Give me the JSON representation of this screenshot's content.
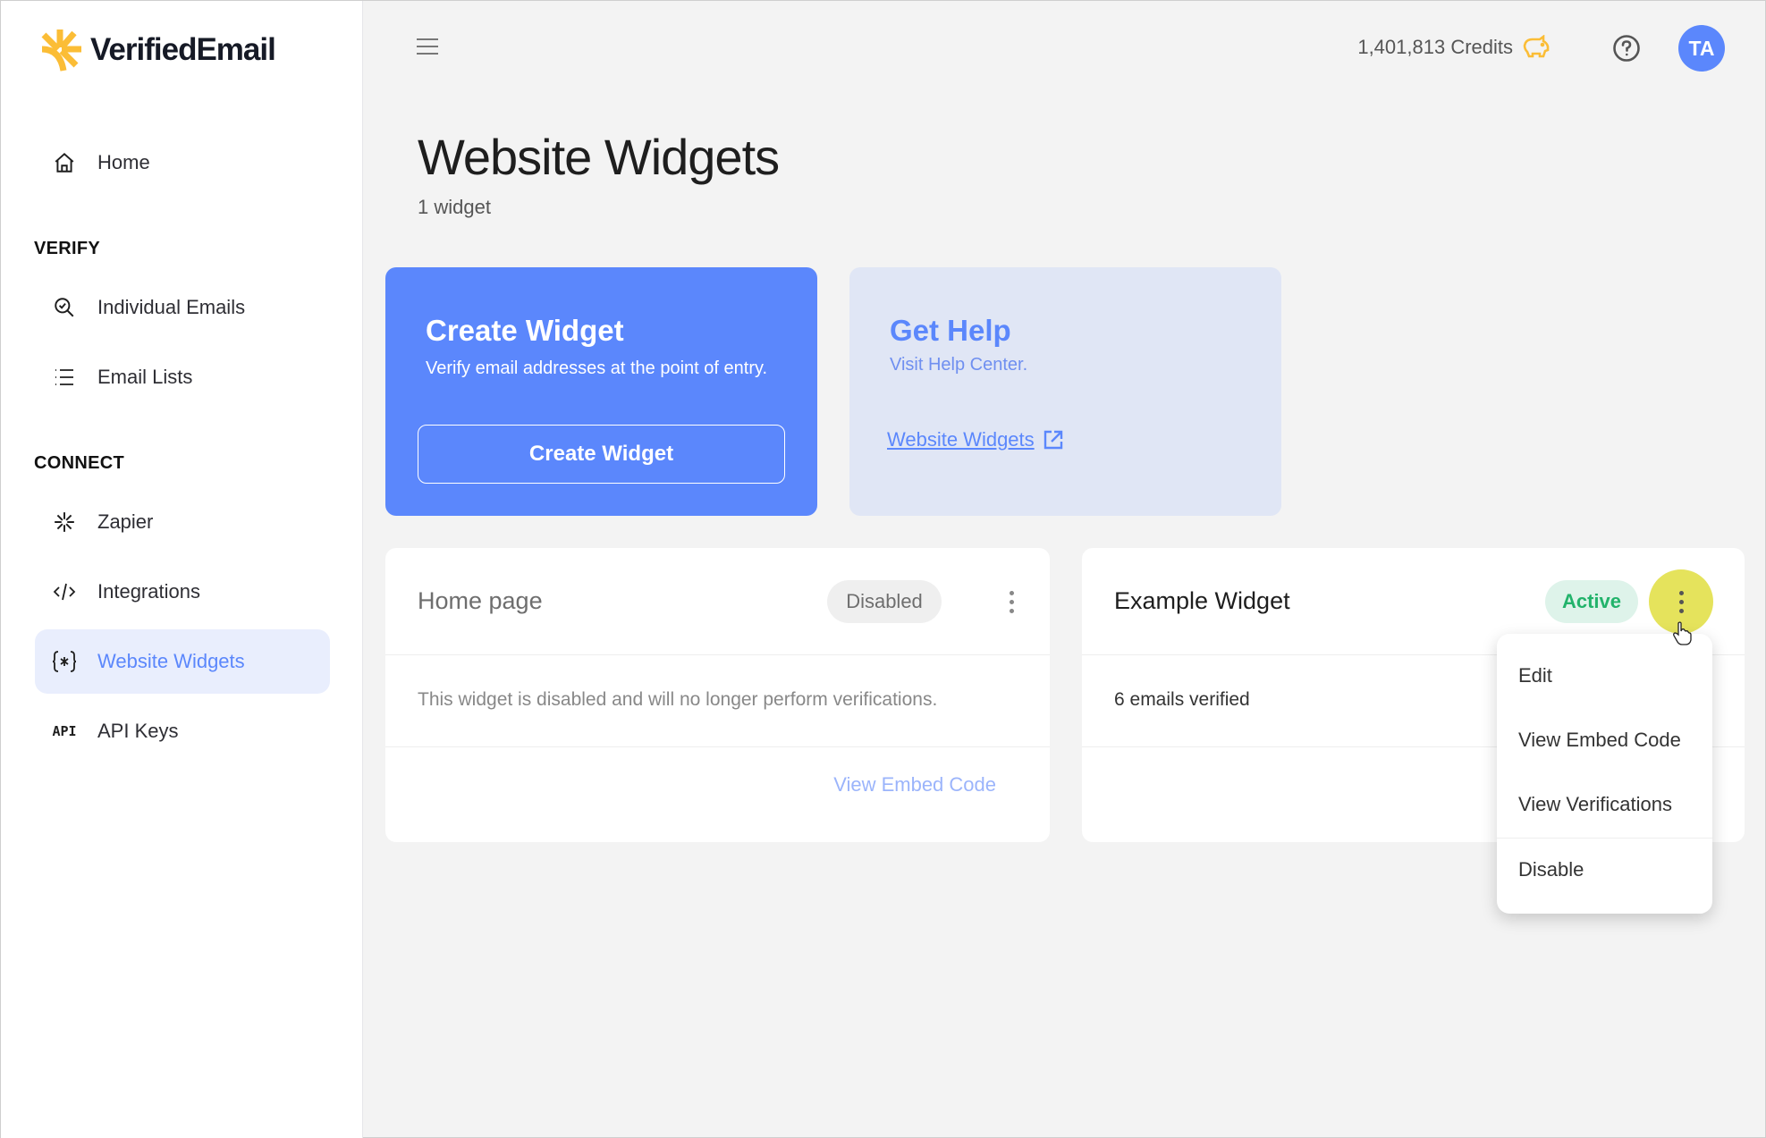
{
  "brand": {
    "name": "VerifiedEmail",
    "accent": "#5b87fc",
    "logo_color": "#fbbd36"
  },
  "sidebar": {
    "home": {
      "label": "Home",
      "icon": "home-icon"
    },
    "sections": [
      {
        "label": "VERIFY",
        "items": [
          {
            "label": "Individual Emails",
            "icon": "search-check-icon"
          },
          {
            "label": "Email Lists",
            "icon": "list-icon"
          }
        ]
      },
      {
        "label": "CONNECT",
        "items": [
          {
            "label": "Zapier",
            "icon": "zapier-icon"
          },
          {
            "label": "Integrations",
            "icon": "code-icon"
          },
          {
            "label": "Website Widgets",
            "icon": "braces-asterisk-icon",
            "active": true
          },
          {
            "label": "API Keys",
            "icon": "api-icon",
            "icon_text": "API"
          }
        ]
      }
    ]
  },
  "header": {
    "credits": "1,401,813 Credits",
    "avatar_initials": "TA"
  },
  "page": {
    "title": "Website Widgets",
    "subtitle": "1 widget"
  },
  "create_card": {
    "title": "Create Widget",
    "description": "Verify email addresses at the point of entry.",
    "button_label": "Create Widget"
  },
  "help_card": {
    "title": "Get Help",
    "description": "Visit Help Center.",
    "link_label": "Website Widgets"
  },
  "widgets": [
    {
      "name": "Home page",
      "status": "Disabled",
      "body": "This widget is disabled and will no longer perform verifications.",
      "footer_link": "View Embed Code"
    },
    {
      "name": "Example Widget",
      "status": "Active",
      "body": "6 emails verified"
    }
  ],
  "dropdown_menu": {
    "items": [
      "Edit",
      "View Embed Code",
      "View Verifications",
      "Disable"
    ]
  }
}
